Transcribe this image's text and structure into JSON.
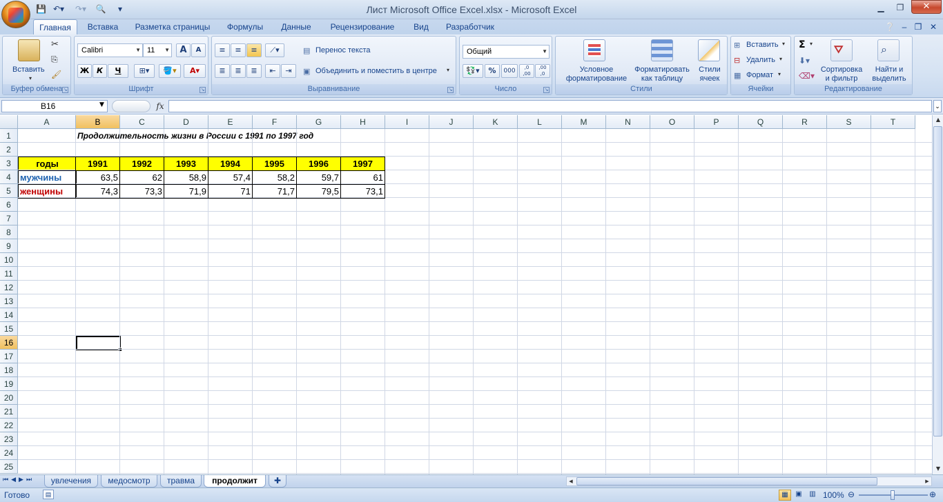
{
  "window": {
    "title": "Лист Microsoft Office Excel.xlsx - Microsoft Excel"
  },
  "ribbon_tabs": [
    "Главная",
    "Вставка",
    "Разметка страницы",
    "Формулы",
    "Данные",
    "Рецензирование",
    "Вид",
    "Разработчик"
  ],
  "ribbon": {
    "clipboard": {
      "label": "Буфер обмена",
      "paste": "Вставить"
    },
    "font": {
      "label": "Шрифт",
      "name": "Calibri",
      "size": "11",
      "bold": "Ж",
      "italic": "К",
      "underline": "Ч",
      "grow": "A",
      "shrink": "A",
      "fontcolor": "A"
    },
    "alignment": {
      "label": "Выравнивание",
      "wrap": "Перенос текста",
      "merge": "Объединить и поместить в центре"
    },
    "number": {
      "label": "Число",
      "format": "Общий",
      "percent": "%",
      "thousands": "000",
      "inc_dec": ",0 ,00",
      "dec_dec": ",00 ,0"
    },
    "styles": {
      "label": "Стили",
      "conditional_1": "Условное",
      "conditional_2": "форматирование",
      "table_1": "Форматировать",
      "table_2": "как таблицу",
      "cell_1": "Стили",
      "cell_2": "ячеек"
    },
    "cells": {
      "label": "Ячейки",
      "insert": "Вставить",
      "delete": "Удалить",
      "format": "Формат"
    },
    "editing": {
      "label": "Редактирование",
      "sum": "Σ",
      "sort_1": "Сортировка",
      "sort_2": "и фильтр",
      "find_1": "Найти и",
      "find_2": "выделить"
    }
  },
  "formula_bar": {
    "name_box": "B16",
    "fx": "fx",
    "value": ""
  },
  "columns": [
    "A",
    "B",
    "C",
    "D",
    "E",
    "F",
    "G",
    "H",
    "I",
    "J",
    "K",
    "L",
    "M",
    "N",
    "O",
    "P",
    "Q",
    "R",
    "S",
    "T"
  ],
  "rows": [
    "1",
    "2",
    "3",
    "4",
    "5",
    "6",
    "7",
    "8",
    "9",
    "10",
    "11",
    "12",
    "13",
    "14",
    "15",
    "16",
    "17",
    "18",
    "19",
    "20",
    "21",
    "22",
    "23",
    "24",
    "25"
  ],
  "sheet": {
    "title": "Продолжительность жизни в России с 1991 по 1997 год",
    "header_label": "годы",
    "years": [
      "1991",
      "1992",
      "1993",
      "1994",
      "1995",
      "1996",
      "1997"
    ],
    "men_label": "мужчины",
    "men": [
      "63,5",
      "62",
      "58,9",
      "57,4",
      "58,2",
      "59,7",
      "61"
    ],
    "women_label": "женщины",
    "women": [
      "74,3",
      "73,3",
      "71,9",
      "71",
      "71,7",
      "79,5",
      "73,1"
    ]
  },
  "sheet_tabs": [
    "увлечения",
    "медосмотр",
    "травма",
    "продолжит"
  ],
  "status": {
    "ready": "Готово",
    "zoom": "100%"
  },
  "colors": {
    "header_fill": "#ffff00",
    "men_text": "#1f63b0",
    "women_text": "#c00000"
  }
}
